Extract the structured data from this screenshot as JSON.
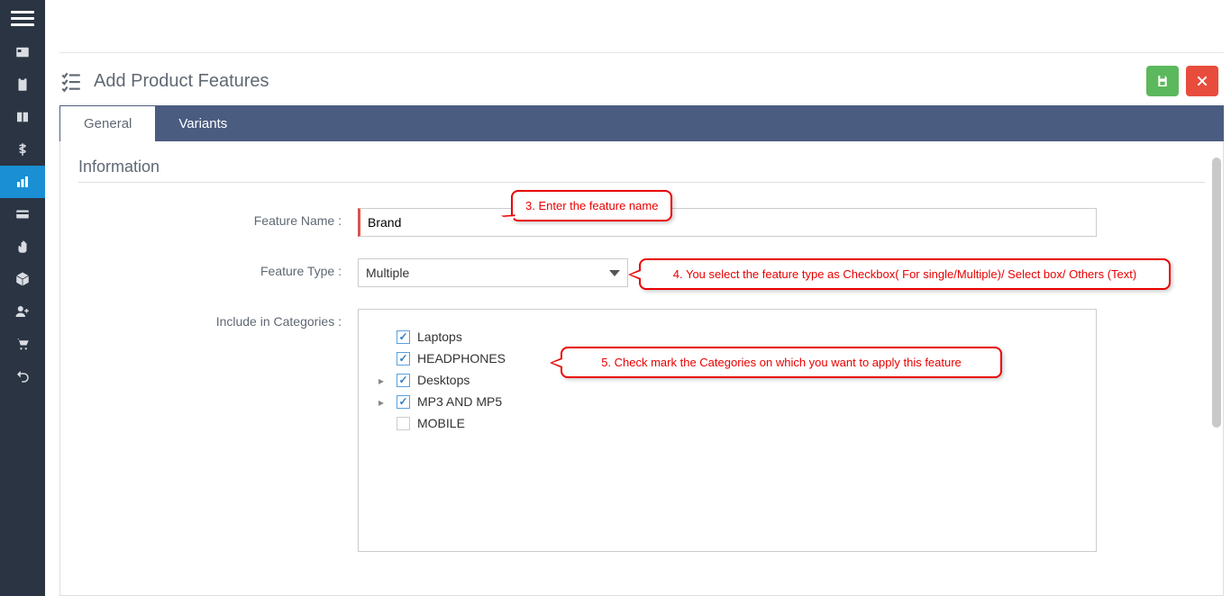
{
  "page": {
    "title": "Add Product Features",
    "tabs": [
      {
        "label": "General",
        "active": true
      },
      {
        "label": "Variants",
        "active": false
      }
    ],
    "section_title": "Information"
  },
  "form": {
    "feature_name_label": "Feature Name :",
    "feature_name_value": "Brand",
    "feature_type_label": "Feature Type :",
    "feature_type_value": "Multiple",
    "include_categories_label": "Include in Categories :"
  },
  "categories": [
    {
      "label": "Laptops",
      "checked": true,
      "expandable": false
    },
    {
      "label": "HEADPHONES",
      "checked": true,
      "expandable": false
    },
    {
      "label": "Desktops",
      "checked": true,
      "expandable": true
    },
    {
      "label": "MP3 AND MP5",
      "checked": true,
      "expandable": true
    },
    {
      "label": "MOBILE",
      "checked": false,
      "expandable": false
    }
  ],
  "callouts": {
    "c1": "3. Enter the feature name",
    "c2": "4. You select the feature type as Checkbox( For single/Multiple)/ Select box/ Others (Text)",
    "c3": "5.  Check mark the Categories on which you want to apply this feature"
  },
  "sidebar_icons": [
    "id-card-icon",
    "clipboard-icon",
    "columns-icon",
    "money-icon",
    "chart-icon",
    "card-icon",
    "hand-icon",
    "box-icon",
    "user-plus-icon",
    "cart-icon",
    "undo-icon"
  ]
}
